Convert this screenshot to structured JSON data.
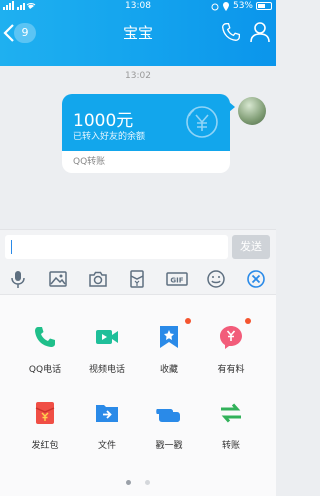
{
  "status_bar": {
    "carrier_text": "中国联通",
    "time": "13:08",
    "battery_text": "53%"
  },
  "nav": {
    "unread_count": "9",
    "title": "宝宝"
  },
  "chat": {
    "timestamp": "13:02",
    "transfer": {
      "amount": "1000元",
      "description": "已转入好友的余额",
      "footer": "QQ转账"
    }
  },
  "input": {
    "value": "",
    "send_label": "发送"
  },
  "toolbar": {
    "icons": [
      "microphone-icon",
      "image-icon",
      "camera-icon",
      "red-packet-icon",
      "gif-icon",
      "emoji-icon",
      "close-panel-icon"
    ]
  },
  "features": [
    {
      "label": "QQ电话",
      "icon": "phone-icon",
      "color": "#1fbf8a",
      "badge": false
    },
    {
      "label": "视频电话",
      "icon": "video-icon",
      "color": "#1fbf9a",
      "badge": false
    },
    {
      "label": "收藏",
      "icon": "bookmark-star-icon",
      "color": "#2a8ae8",
      "badge": true
    },
    {
      "label": "有有料",
      "icon": "yen-bubble-icon",
      "color": "#f25c7a",
      "badge": true
    },
    {
      "label": "发红包",
      "icon": "red-packet-icon",
      "color": "#f04e45",
      "badge": false
    },
    {
      "label": "文件",
      "icon": "folder-icon",
      "color": "#2a8ae8",
      "badge": false
    },
    {
      "label": "戳一戳",
      "icon": "poke-hand-icon",
      "color": "#2a8ae8",
      "badge": false
    },
    {
      "label": "转账",
      "icon": "transfer-arrows-icon",
      "color": "#32b15a",
      "badge": false
    }
  ],
  "pager": {
    "pages": 2,
    "current": 1
  },
  "colors": {
    "header": "#14a4ee",
    "transfer_card": "#12a6ec",
    "send_disabled": "#cfd3d8",
    "notification_dot": "#f4542f"
  }
}
